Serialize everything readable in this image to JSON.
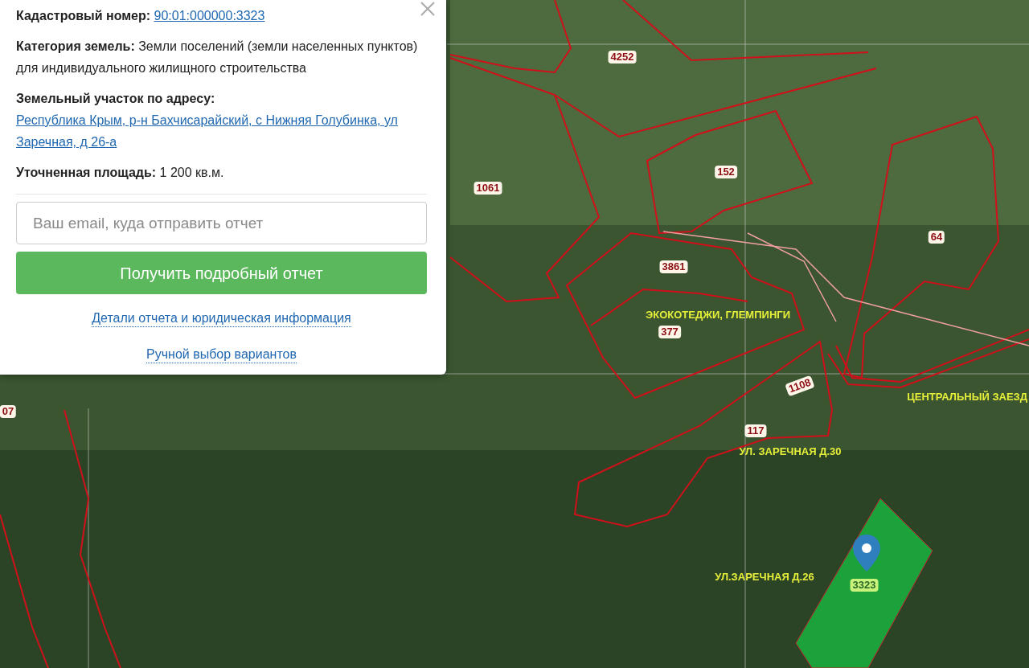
{
  "popup": {
    "cadastral": {
      "label": "Кадастровый номер:",
      "value": "90:01:000000:3323"
    },
    "category": {
      "label": "Категория земель:",
      "value": "Земли поселений (земли населенных пунктов)",
      "usage": "для индивидуального жилищного строительства"
    },
    "address": {
      "label": "Земельный участок по адресу:",
      "value": "Республика Крым, р-н Бахчисарайский, с Нижняя Голубинка, ул Заречная, д 26-а"
    },
    "area": {
      "label": "Уточненная площадь:",
      "value": "1 200 кв.м."
    },
    "email": {
      "placeholder": "Ваш email, куда отправить отчет"
    },
    "submit": "Получить подробный отчет",
    "links": [
      "Детали отчета и юридическая информация",
      "Ручной выбор вариантов"
    ]
  },
  "map": {
    "parcel_labels": [
      "4252",
      "1061",
      "152",
      "3861",
      "377",
      "64",
      "1108",
      "117",
      "07"
    ],
    "street_labels": [
      "ЭКОКОТЕДЖИ, ГЛЕМПИНГИ",
      "ЦЕНТРАЛЬНЫЙ ЗАЕЗД",
      "УЛ. ЗАРЕЧНАЯ Д.30",
      "УЛ.ЗАРЕЧНАЯ Д.26"
    ],
    "selected_parcel": "3323"
  }
}
